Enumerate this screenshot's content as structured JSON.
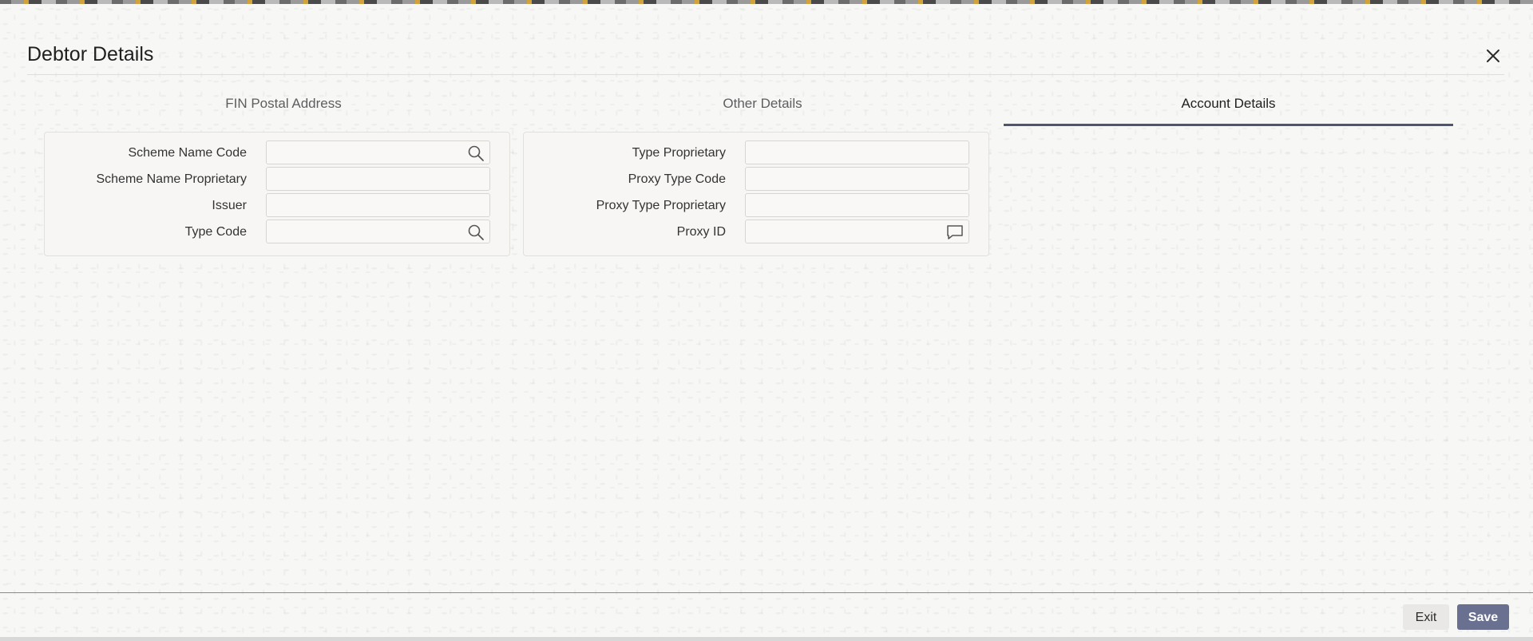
{
  "dialog": {
    "title": "Debtor Details",
    "close_icon": "close-icon"
  },
  "tabs": [
    {
      "label": "FIN Postal Address",
      "active": false
    },
    {
      "label": "Other Details",
      "active": false
    },
    {
      "label": "Account Details",
      "active": true
    }
  ],
  "left_panel": {
    "fields": [
      {
        "label": "Scheme Name Code",
        "value": "",
        "icon": "search-icon"
      },
      {
        "label": "Scheme Name Proprietary",
        "value": ""
      },
      {
        "label": "Issuer",
        "value": ""
      },
      {
        "label": "Type Code",
        "value": "",
        "icon": "search-icon"
      }
    ]
  },
  "right_panel": {
    "fields": [
      {
        "label": "Type Proprietary",
        "value": ""
      },
      {
        "label": "Proxy Type Code",
        "value": ""
      },
      {
        "label": "Proxy Type Proprietary",
        "value": ""
      },
      {
        "label": "Proxy ID",
        "value": "",
        "icon": "comment-icon"
      }
    ]
  },
  "footer": {
    "exit_label": "Exit",
    "save_label": "Save"
  },
  "colors": {
    "accent": "#4d5570",
    "save_button": "#6a7190"
  }
}
